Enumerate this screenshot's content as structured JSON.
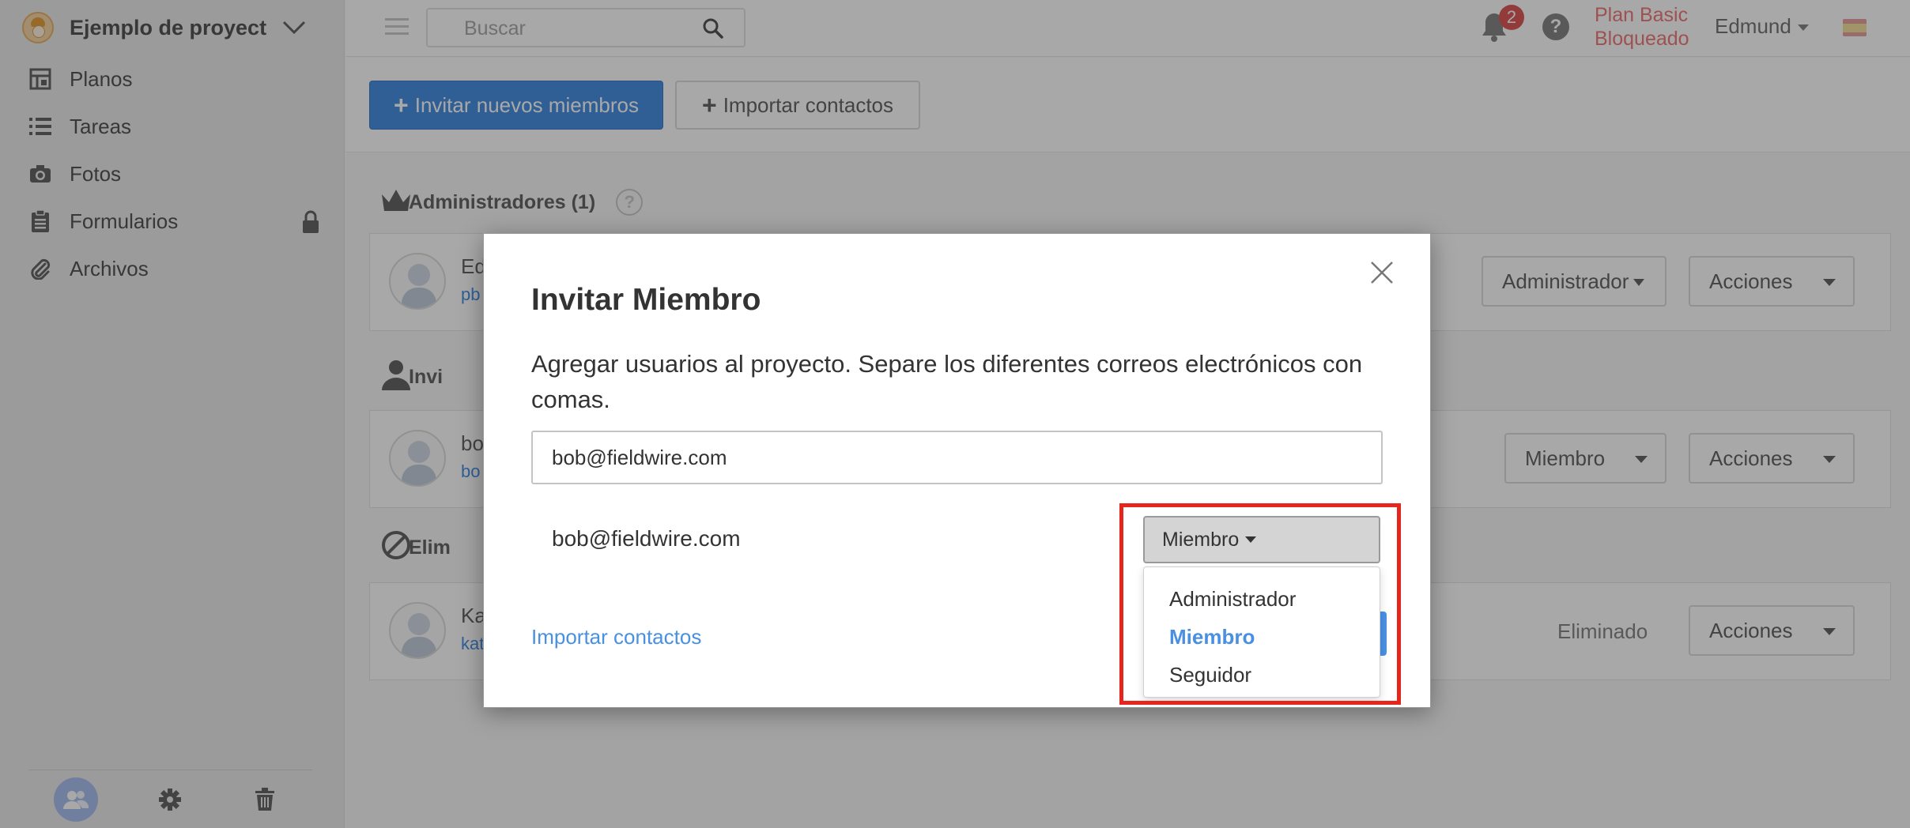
{
  "sidebar": {
    "project_name": "Ejemplo de proyect...",
    "items": [
      {
        "label": "Planos",
        "icon": "blueprint-icon"
      },
      {
        "label": "Tareas",
        "icon": "list-icon"
      },
      {
        "label": "Fotos",
        "icon": "camera-icon"
      },
      {
        "label": "Formularios",
        "icon": "clipboard-icon",
        "locked": true
      },
      {
        "label": "Archivos",
        "icon": "paperclip-icon"
      }
    ],
    "bottom": [
      "people-icon",
      "gear-icon",
      "trash-icon"
    ]
  },
  "topbar": {
    "search_placeholder": "Buscar",
    "notification_count": "2",
    "help": "?",
    "plan_line1": "Plan Basic",
    "plan_line2": "Bloqueado",
    "user": "Edmund"
  },
  "toolbar": {
    "invite_label": "Invitar nuevos miembros",
    "import_label": "Importar contactos"
  },
  "sections": {
    "admins_title": "Administradores (1)",
    "help": "?",
    "invited_title": "Invi",
    "removed_title": "Elim"
  },
  "rows": [
    {
      "name": "Ed",
      "email": "pb",
      "role": "Administrador",
      "actions": "Acciones"
    },
    {
      "name": "bo",
      "email": "bo",
      "role": "Miembro",
      "actions": "Acciones"
    },
    {
      "name": "Ka",
      "email": "kat",
      "status": "Eliminado",
      "actions": "Acciones"
    }
  ],
  "modal": {
    "title": "Invitar Miembro",
    "description": "Agregar usuarios al proyecto. Separe los diferentes correos electrónicos con comas.",
    "email_value": "bob@fieldwire.com",
    "row_email": "bob@fieldwire.com",
    "role_selected": "Miembro",
    "role_options": [
      "Administrador",
      "Miembro",
      "Seguidor"
    ],
    "import_link": "Importar contactos"
  },
  "colors": {
    "accent": "#4a90e2",
    "plan_text": "#f07c7c",
    "highlight": "#e4261d"
  }
}
